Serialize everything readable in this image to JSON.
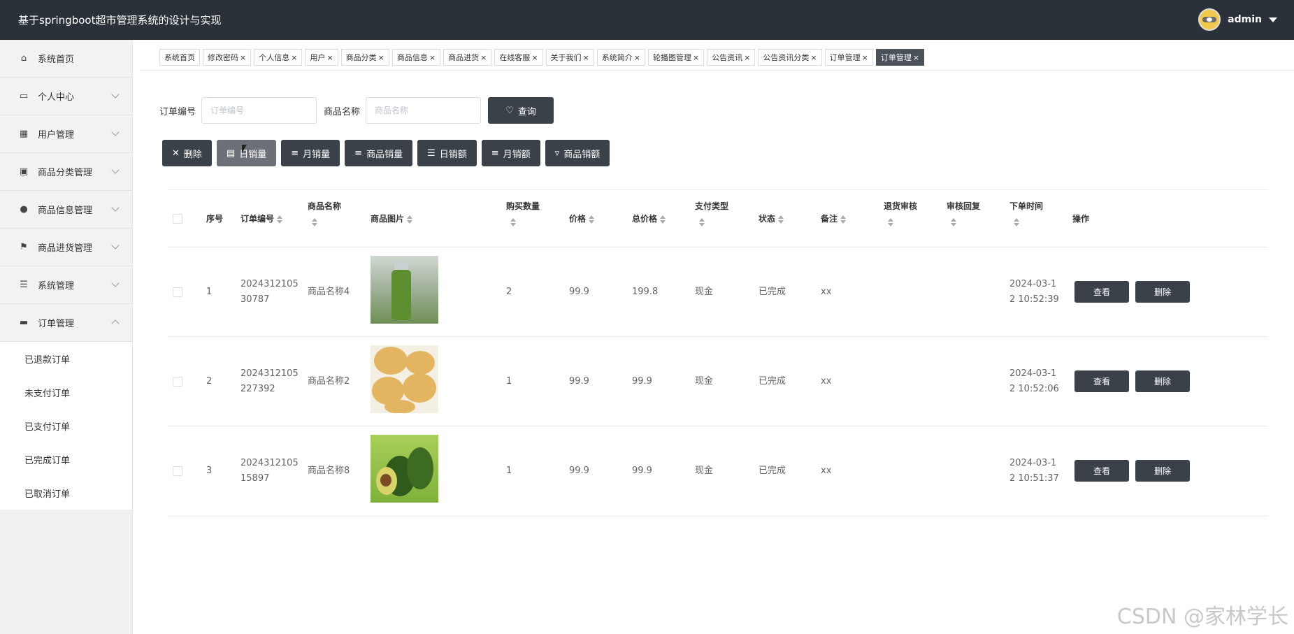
{
  "header": {
    "title": "基于springboot超市管理系统的设计与实现",
    "username": "admin"
  },
  "sidebar": {
    "items": [
      {
        "label": "系统首页",
        "icon": "home-icon"
      },
      {
        "label": "个人中心",
        "icon": "card-icon"
      },
      {
        "label": "用户管理",
        "icon": "grid-icon"
      },
      {
        "label": "商品分类管理",
        "icon": "clipboard-icon"
      },
      {
        "label": "商品信息管理",
        "icon": "pin-icon"
      },
      {
        "label": "商品进货管理",
        "icon": "flag-icon"
      },
      {
        "label": "系统管理",
        "icon": "list-icon"
      },
      {
        "label": "订单管理",
        "icon": "order-icon"
      }
    ],
    "submenu": [
      "已退款订单",
      "未支付订单",
      "已支付订单",
      "已完成订单",
      "已取消订单"
    ]
  },
  "tabs": [
    "系统首页",
    "修改密码",
    "个人信息",
    "用户",
    "商品分类",
    "商品信息",
    "商品进货",
    "在线客服",
    "关于我们",
    "系统简介",
    "轮播图管理",
    "公告资讯",
    "公告资讯分类",
    "订单管理",
    "订单管理"
  ],
  "search": {
    "order_label": "订单编号",
    "order_placeholder": "订单编号",
    "name_label": "商品名称",
    "name_placeholder": "商品名称",
    "query_button": "查询"
  },
  "actions": [
    "删除",
    "日销量",
    "月销量",
    "商品销量",
    "日销额",
    "月销额",
    "商品销额"
  ],
  "table": {
    "headers": [
      "序号",
      "订单编号",
      "商品名称",
      "商品图片",
      "购买数量",
      "价格",
      "总价格",
      "支付类型",
      "状态",
      "备注",
      "退货审核",
      "审核回复",
      "下单时间",
      "操作"
    ],
    "rows": [
      {
        "index": "1",
        "order_no_a": "2024312105",
        "order_no_b": "30787",
        "name": "商品名称4",
        "image": "bottle",
        "qty": "2",
        "price": "99.9",
        "total": "199.8",
        "pay": "现金",
        "status": "已完成",
        "remark": "xx",
        "time_a": "2024-03-1",
        "time_b": "2 10:52:39"
      },
      {
        "index": "2",
        "order_no_a": "2024312105",
        "order_no_b": "227392",
        "name": "商品名称2",
        "image": "potato",
        "qty": "1",
        "price": "99.9",
        "total": "99.9",
        "pay": "现金",
        "status": "已完成",
        "remark": "xx",
        "time_a": "2024-03-1",
        "time_b": "2 10:52:06"
      },
      {
        "index": "3",
        "order_no_a": "2024312105",
        "order_no_b": "15897",
        "name": "商品名称8",
        "image": "avocado",
        "qty": "1",
        "price": "99.9",
        "total": "99.9",
        "pay": "现金",
        "status": "已完成",
        "remark": "xx",
        "time_a": "2024-03-1",
        "time_b": "2 10:51:37"
      }
    ],
    "view_label": "查看",
    "delete_label": "删除"
  },
  "watermark": "CSDN @家林学长"
}
